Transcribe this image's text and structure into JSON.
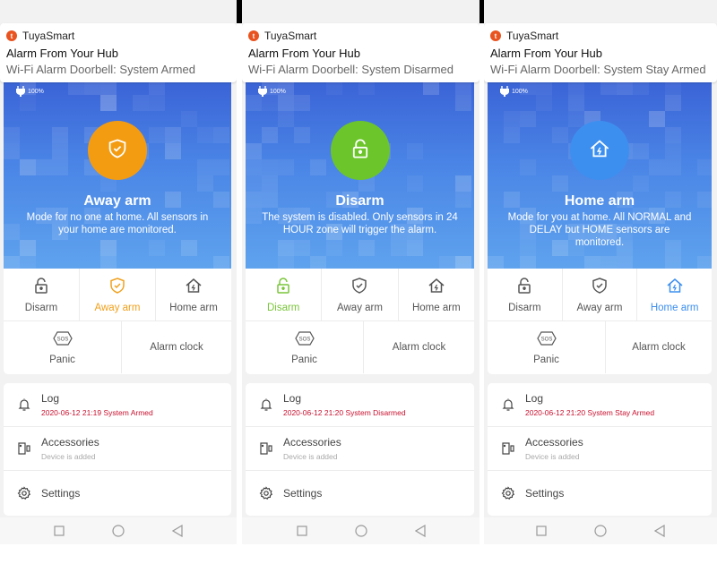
{
  "panels": [
    {
      "notification": {
        "app_name": "TuyaSmart",
        "title": "Alarm From Your Hub",
        "body": "Wi-Fi Alarm Doorbell: System Armed"
      },
      "battery": "100%",
      "mode": {
        "icon": "shield-check-icon",
        "color": "#f39c12",
        "title": "Away arm",
        "description": "Mode for no one at home. All sensors in your home are monitored."
      },
      "active_mode": "away",
      "buttons": {
        "disarm": "Disarm",
        "away_arm": "Away arm",
        "home_arm": "Home arm",
        "panic": "Panic",
        "alarm_clock": "Alarm clock"
      },
      "list": {
        "log_title": "Log",
        "log_sub": "2020-06-12 21:19 System Armed",
        "accessories_title": "Accessories",
        "accessories_sub": "Device is added",
        "settings_title": "Settings"
      }
    },
    {
      "notification": {
        "app_name": "TuyaSmart",
        "title": "Alarm From Your Hub",
        "body": "Wi-Fi Alarm Doorbell: System Disarmed"
      },
      "battery": "100%",
      "mode": {
        "icon": "unlock-icon",
        "color": "#6cc52a",
        "title": "Disarm",
        "description": "The system is disabled. Only sensors in 24 HOUR zone will trigger the alarm."
      },
      "active_mode": "disarm",
      "buttons": {
        "disarm": "Disarm",
        "away_arm": "Away arm",
        "home_arm": "Home arm",
        "panic": "Panic",
        "alarm_clock": "Alarm clock"
      },
      "list": {
        "log_title": "Log",
        "log_sub": "2020-06-12 21:20 System Disarmed",
        "accessories_title": "Accessories",
        "accessories_sub": "Device is added",
        "settings_title": "Settings"
      }
    },
    {
      "notification": {
        "app_name": "TuyaSmart",
        "title": "Alarm From Your Hub",
        "body": "Wi-Fi Alarm Doorbell: System Stay Armed"
      },
      "battery": "100%",
      "mode": {
        "icon": "home-bolt-icon",
        "color": "#3d8fef",
        "title": "Home arm",
        "description": "Mode for you at home. All NORMAL and DELAY but HOME sensors are monitored."
      },
      "active_mode": "home",
      "buttons": {
        "disarm": "Disarm",
        "away_arm": "Away arm",
        "home_arm": "Home arm",
        "panic": "Panic",
        "alarm_clock": "Alarm clock"
      },
      "list": {
        "log_title": "Log",
        "log_sub": "2020-06-12 21:20 System Stay Armed",
        "accessories_title": "Accessories",
        "accessories_sub": "Device is added",
        "settings_title": "Settings"
      }
    }
  ],
  "colors": {
    "away": "#f0a01c",
    "disarm": "#7ac53a",
    "home": "#3d8fef",
    "inactive": "#555555",
    "log_red": "#c8102e"
  },
  "nav_icons": [
    "recent-apps-icon",
    "home-icon",
    "back-icon"
  ]
}
